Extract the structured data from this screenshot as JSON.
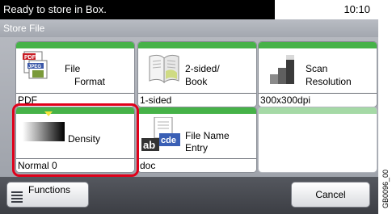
{
  "status": {
    "message": "Ready to store in Box.",
    "time": "10:10"
  },
  "screen_title": "Store File",
  "tiles": [
    {
      "label_line1": "File",
      "label_line2": "Format",
      "value": "PDF",
      "icon": "pdf-jpeg-file-icon"
    },
    {
      "label_line1": "2-sided/",
      "label_line2": "Book",
      "value": "1-sided",
      "icon": "open-book-icon"
    },
    {
      "label_line1": "Scan",
      "label_line2": "Resolution",
      "value": "300x300dpi",
      "icon": "resolution-steps-icon"
    },
    {
      "label_line1": "Density",
      "value": "Normal 0",
      "icon": "density-gradient-icon"
    },
    {
      "label_line1": "File Name",
      "label_line2": "Entry",
      "value": "doc",
      "icon": "abc-name-entry-icon"
    }
  ],
  "buttons": {
    "functions": "Functions",
    "cancel": "Cancel"
  },
  "image_code": "GB0096_00",
  "colors": {
    "accent_green": "#46b248",
    "highlight_red": "#e0001a",
    "status_bar": "#000000"
  }
}
